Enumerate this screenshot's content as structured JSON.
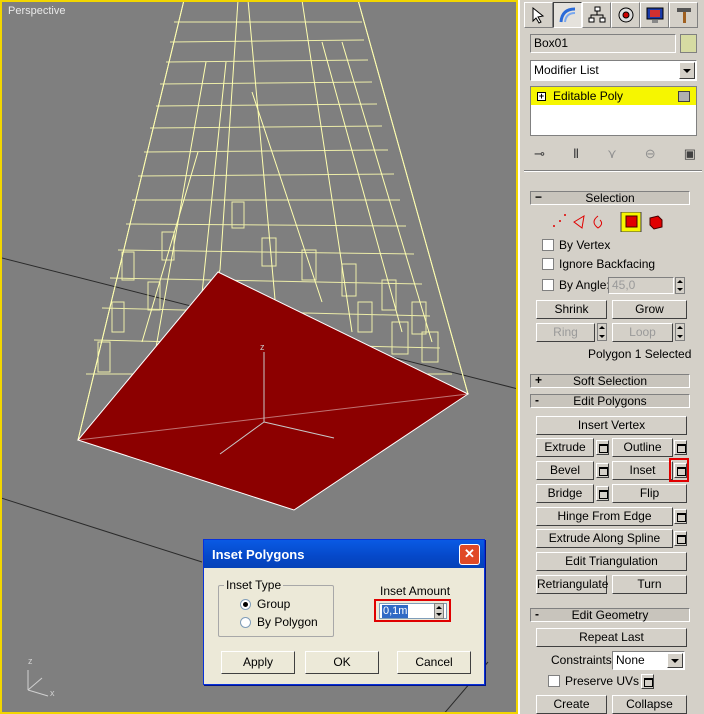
{
  "viewport": {
    "label": "Perspective",
    "axis_x": "x",
    "axis_z": "z"
  },
  "panel": {
    "object_name": "Box01",
    "modifier_list": "Modifier List",
    "stack_item": "Editable Poly",
    "selection": {
      "title": "Selection",
      "by_vertex": "By Vertex",
      "ignore_backfacing": "Ignore Backfacing",
      "by_angle": "By Angle:",
      "angle_value": "45,0",
      "shrink": "Shrink",
      "grow": "Grow",
      "ring": "Ring",
      "loop": "Loop",
      "status": "Polygon 1 Selected"
    },
    "soft_selection": {
      "sign": "+",
      "title": "Soft Selection"
    },
    "edit_polygons": {
      "sign": "-",
      "title": "Edit Polygons",
      "insert_vertex": "Insert Vertex",
      "extrude": "Extrude",
      "outline": "Outline",
      "bevel": "Bevel",
      "inset": "Inset",
      "bridge": "Bridge",
      "flip": "Flip",
      "hinge_from_edge": "Hinge From Edge",
      "extrude_along_spline": "Extrude Along Spline",
      "edit_triangulation": "Edit Triangulation",
      "retriangulate": "Retriangulate",
      "turn": "Turn"
    },
    "edit_geometry": {
      "sign": "-",
      "title": "Edit Geometry",
      "repeat_last": "Repeat Last",
      "constraints_label": "Constraints:",
      "constraints_value": "None",
      "preserve_uvs": "Preserve UVs",
      "create": "Create",
      "collapse": "Collapse"
    }
  },
  "dialog": {
    "title": "Inset Polygons",
    "close": "✕",
    "inset_type_label": "Inset Type",
    "option_group": "Group",
    "option_by_polygon": "By Polygon",
    "inset_amount_label": "Inset Amount",
    "inset_amount_value": "0,1m",
    "apply": "Apply",
    "ok": "OK",
    "cancel": "Cancel"
  },
  "colors": {
    "viewport_bg": "#7f7f7f",
    "wireframe": "#ffffb0",
    "selected_face": "#8c0000",
    "highlight_border": "#f2d600",
    "callout": "#e00000"
  }
}
